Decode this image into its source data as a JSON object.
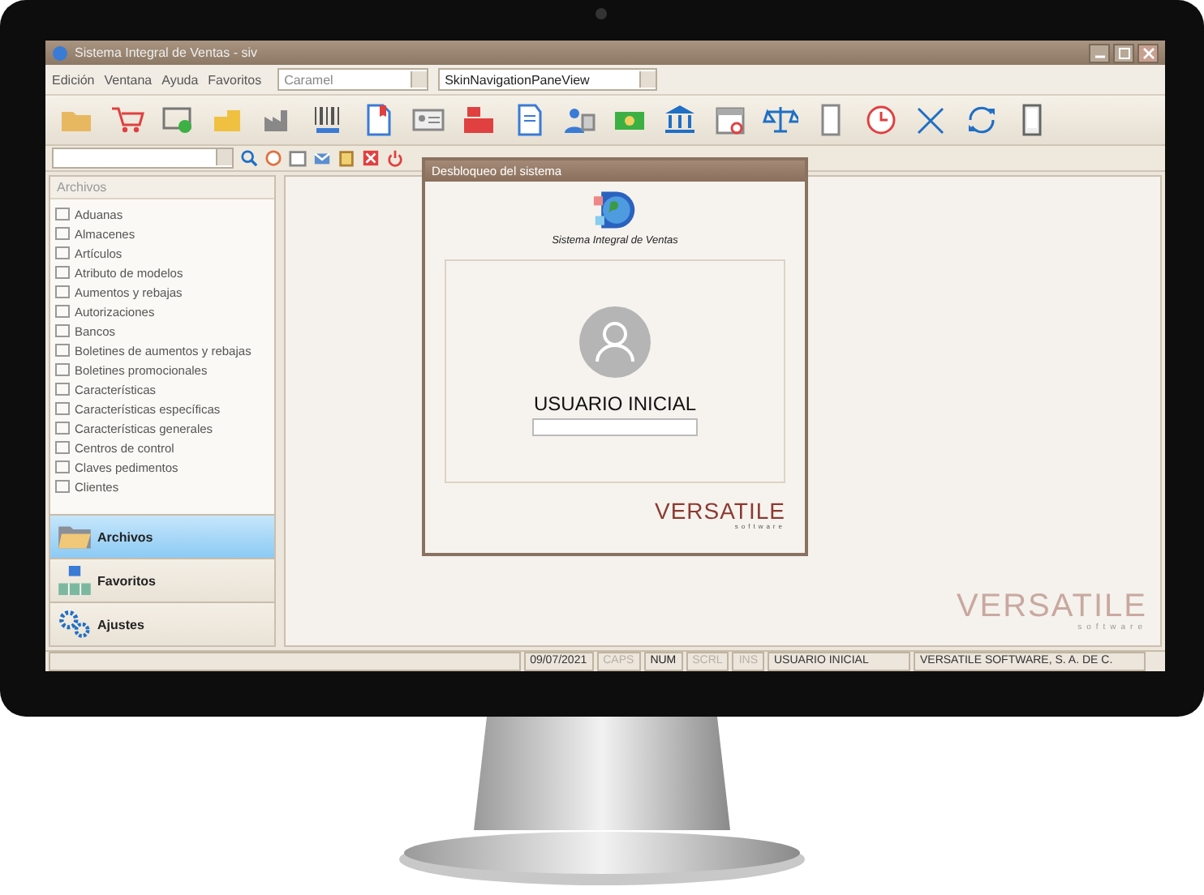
{
  "window": {
    "title": "Sistema Integral de Ventas - siv"
  },
  "menu": [
    "Edición",
    "Ventana",
    "Ayuda",
    "Favoritos"
  ],
  "skin_combo": {
    "value": "Caramel"
  },
  "view_combo": {
    "value": "SkinNavigationPaneView"
  },
  "nav_pane": {
    "header": "Archivos",
    "items": [
      "Aduanas",
      "Almacenes",
      "Artículos",
      "Atributo de modelos",
      "Aumentos y rebajas",
      "Autorizaciones",
      "Bancos",
      "Boletines de aumentos y rebajas",
      "Boletines promocionales",
      "Características",
      "Características específicas",
      "Características generales",
      "Centros de control",
      "Claves pedimentos",
      "Clientes"
    ],
    "groups": [
      {
        "label": "Archivos",
        "kind": "folder",
        "selected": true
      },
      {
        "label": "Favoritos",
        "kind": "tree",
        "selected": false
      },
      {
        "label": "Ajustes",
        "kind": "gears",
        "selected": false
      }
    ]
  },
  "dialog": {
    "title": "Desbloqueo del sistema",
    "app_name": "Sistema Integral de Ventas",
    "user_name": "USUARIO INICIAL",
    "brand": "VERSATILE",
    "brand_sub": "software"
  },
  "background_logo": {
    "brand": "VERSATILE",
    "sub": "software"
  },
  "status_bar": {
    "date": "09/07/2021",
    "indicators": [
      {
        "label": "CAPS",
        "on": false
      },
      {
        "label": "NUM",
        "on": true
      },
      {
        "label": "SCRL",
        "on": false
      },
      {
        "label": "INS",
        "on": false
      }
    ],
    "user": "USUARIO INICIAL",
    "company": "VERSATILE SOFTWARE, S. A. DE C."
  }
}
